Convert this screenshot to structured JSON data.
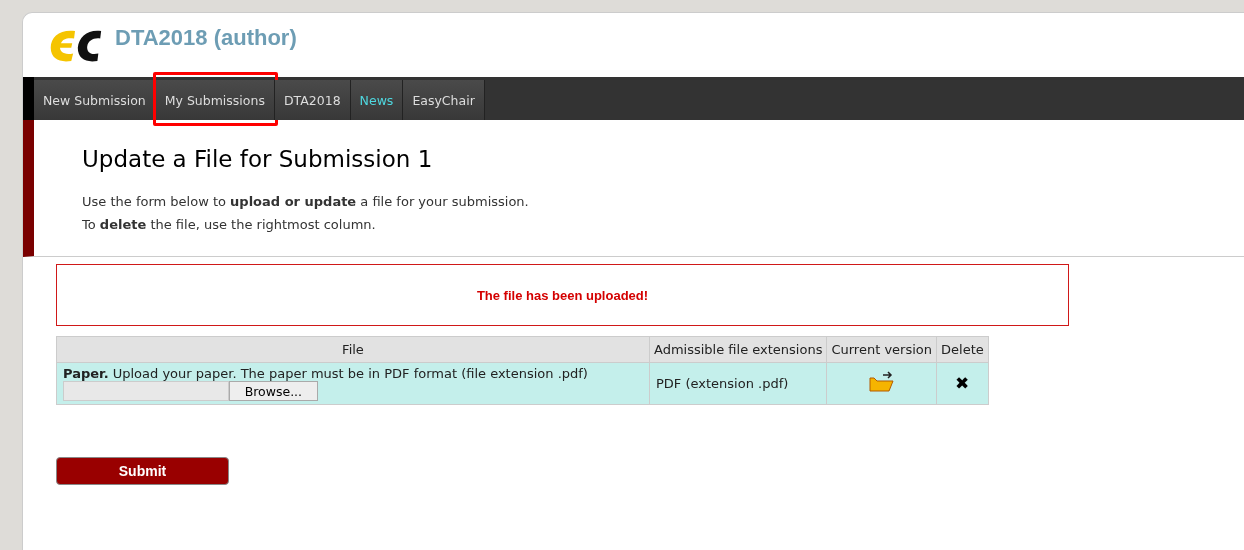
{
  "header": {
    "title": "DTA2018 (author)"
  },
  "nav_tabs": [
    {
      "label": "New Submission",
      "selected": false,
      "highlighted": false
    },
    {
      "label": "My Submissions",
      "selected": false,
      "highlighted": true
    },
    {
      "label": "DTA2018",
      "selected": false,
      "highlighted": false
    },
    {
      "label": "News",
      "selected": true,
      "highlighted": false
    },
    {
      "label": "EasyChair",
      "selected": false,
      "highlighted": false
    }
  ],
  "page": {
    "heading": "Update a File for Submission 1",
    "intro": [
      "Use the form below to **upload or update** a file for your submission.",
      "To **delete** the file, use the rightmost column."
    ]
  },
  "message": "The file has been uploaded!",
  "table": {
    "columns": [
      "File",
      "Admissible file extensions",
      "Current version",
      "Delete"
    ],
    "rows": [
      {
        "description": "**Paper.** Upload your paper. The paper must be in PDF format (file extension .pdf)",
        "browse_button": "Browse...",
        "extensions": "PDF (extension .pdf)",
        "delete_icon": "✖"
      }
    ]
  },
  "submit_button": "Submit"
}
